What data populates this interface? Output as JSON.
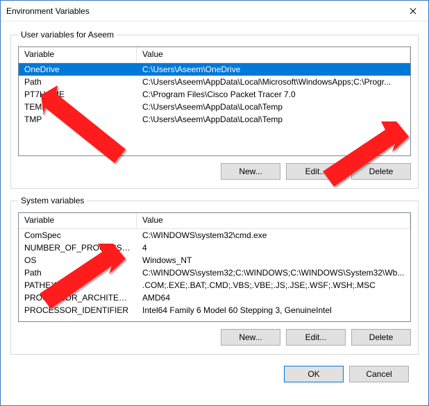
{
  "window": {
    "title": "Environment Variables"
  },
  "user_section": {
    "legend": "User variables for Aseem",
    "columns": {
      "var": "Variable",
      "val": "Value"
    },
    "rows": [
      {
        "var": "OneDrive",
        "val": "C:\\Users\\Aseem\\OneDrive",
        "selected": true
      },
      {
        "var": "Path",
        "val": "C:\\Users\\Aseem\\AppData\\Local\\Microsoft\\WindowsApps;C:\\Progr..."
      },
      {
        "var": "PT7HOME",
        "val": "C:\\Program Files\\Cisco Packet Tracer 7.0"
      },
      {
        "var": "TEMP",
        "val": "C:\\Users\\Aseem\\AppData\\Local\\Temp"
      },
      {
        "var": "TMP",
        "val": "C:\\Users\\Aseem\\AppData\\Local\\Temp"
      }
    ],
    "buttons": {
      "new": "New...",
      "edit": "Edit...",
      "delete": "Delete"
    }
  },
  "system_section": {
    "legend": "System variables",
    "columns": {
      "var": "Variable",
      "val": "Value"
    },
    "rows": [
      {
        "var": "ComSpec",
        "val": "C:\\WINDOWS\\system32\\cmd.exe"
      },
      {
        "var": "NUMBER_OF_PROCESSORS",
        "val": "4"
      },
      {
        "var": "OS",
        "val": "Windows_NT"
      },
      {
        "var": "Path",
        "val": "C:\\WINDOWS\\system32;C:\\WINDOWS;C:\\WINDOWS\\System32\\Wb..."
      },
      {
        "var": "PATHEXT",
        "val": ".COM;.EXE;.BAT;.CMD;.VBS;.VBE;.JS;.JSE;.WSF;.WSH;.MSC"
      },
      {
        "var": "PROCESSOR_ARCHITECTURE",
        "val": "AMD64"
      },
      {
        "var": "PROCESSOR_IDENTIFIER",
        "val": "Intel64 Family 6 Model 60 Stepping 3, GenuineIntel"
      }
    ],
    "buttons": {
      "new": "New...",
      "edit": "Edit...",
      "delete": "Delete"
    }
  },
  "footer": {
    "ok": "OK",
    "cancel": "Cancel"
  }
}
